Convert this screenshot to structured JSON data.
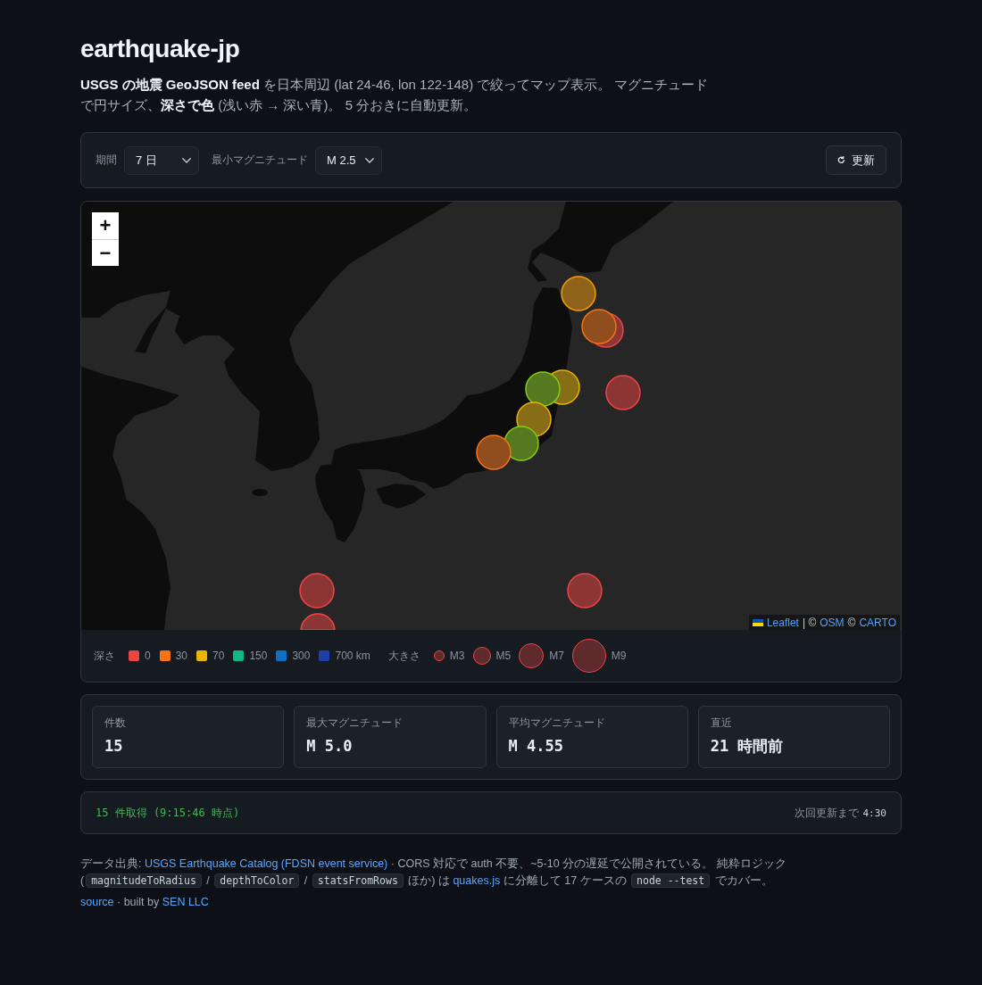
{
  "header": {
    "title": "earthquake-jp",
    "description": "**USGS の地震 GeoJSON feed** を日本周辺 (lat 24-46, lon 122-148) で絞ってマップ表示。 マグニチュードで円サイズ、**深さで色** (浅い赤 → 深い青)。 5 分おきに自動更新。"
  },
  "controls": {
    "filters": [
      {
        "label": "期間",
        "value": "7 日"
      },
      {
        "label": "最小マグニチュード",
        "value": "M 2.5"
      }
    ],
    "refresh_button": "更新"
  },
  "map": {
    "zoom_in": "+",
    "zoom_out": "−",
    "markers": [
      {
        "color": "#f59e0b"
      },
      {
        "color": "#ef4444"
      },
      {
        "color": "#f97316"
      },
      {
        "color": "#ef4444"
      },
      {
        "color": "#eab308"
      },
      {
        "color": "#84cc16"
      },
      {
        "color": "#eab308"
      },
      {
        "color": "#84cc16"
      },
      {
        "color": "#f97316"
      },
      {
        "color": "#ef4444"
      },
      {
        "color": "#ef4444"
      },
      {
        "color": "#ef4444"
      }
    ],
    "attribution": [
      {
        "kind": "link",
        "text": "Leaflet"
      },
      {
        "kind": "text",
        "text": "| ©"
      },
      {
        "kind": "link",
        "text": "OSM"
      },
      {
        "kind": "text",
        "text": "©"
      },
      {
        "kind": "link",
        "text": "CARTO"
      }
    ]
  },
  "legend": {
    "depth_label": "深さ",
    "depth_items": [
      {
        "label": "0",
        "color": "#ef4444"
      },
      {
        "label": "30",
        "color": "#f97316"
      },
      {
        "label": "70",
        "color": "#eab308"
      },
      {
        "label": "150",
        "color": "#10b981"
      },
      {
        "label": "300",
        "color": "#0f6fc6"
      },
      {
        "label": "700 km",
        "color": "#1e40af"
      }
    ],
    "size_label": "大きさ",
    "size_items": [
      {
        "label": "M3"
      },
      {
        "label": "M5"
      },
      {
        "label": "M7"
      },
      {
        "label": "M9"
      }
    ]
  },
  "stats": [
    {
      "label": "件数",
      "value": "15"
    },
    {
      "label": "最大マグニチュード",
      "value": "M 5.0"
    },
    {
      "label": "平均マグニチュード",
      "value": "M 4.55"
    },
    {
      "label": "直近",
      "value": "21 時間前"
    }
  ],
  "status": {
    "message": "15 件取得 (9:15:46 時点)",
    "next_label": "次回更新まで",
    "countdown": "4:30"
  },
  "footer": {
    "credits": [
      {
        "kind": "text",
        "text": "データ出典: "
      },
      {
        "kind": "link",
        "text": "USGS Earthquake Catalog (FDSN event service)"
      },
      {
        "kind": "text",
        "text": " · CORS 対応で auth 不要、~5-10 分の遅延で公開されている。 純粋ロジック ("
      },
      {
        "kind": "code",
        "text": "magnitudeToRadius"
      },
      {
        "kind": "text",
        "text": " / "
      },
      {
        "kind": "code",
        "text": "depthToColor"
      },
      {
        "kind": "text",
        "text": " / "
      },
      {
        "kind": "code",
        "text": "statsFromRows"
      },
      {
        "kind": "text",
        "text": " ほか) は "
      },
      {
        "kind": "link",
        "text": "quakes.js"
      },
      {
        "kind": "text",
        "text": " に分離して 17 ケースの "
      },
      {
        "kind": "code",
        "text": "node --test"
      },
      {
        "kind": "text",
        "text": " でカバー。"
      }
    ],
    "built_by": [
      {
        "kind": "link",
        "text": "source"
      },
      {
        "kind": "text",
        "text": " · built by "
      },
      {
        "kind": "link",
        "text": "SEN LLC"
      }
    ]
  }
}
